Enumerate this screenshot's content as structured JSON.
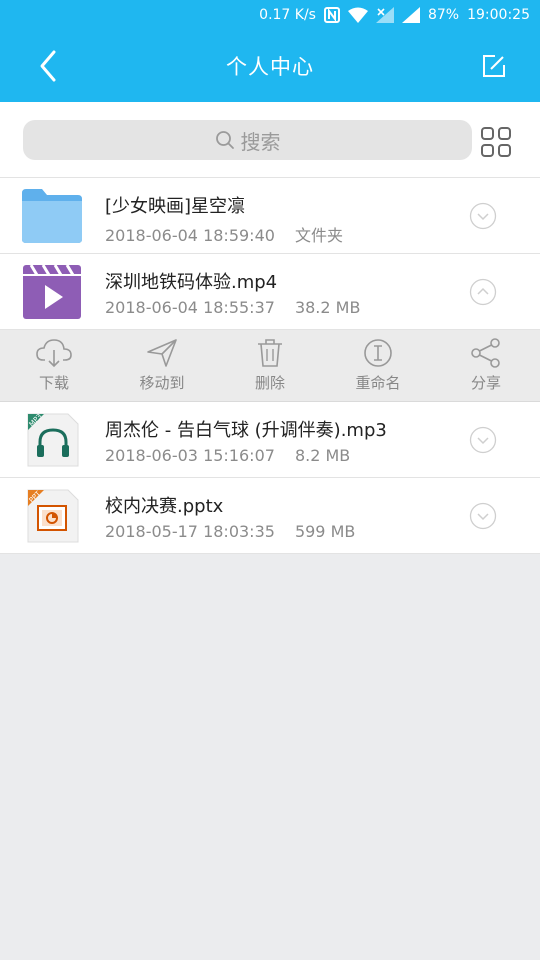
{
  "status_bar": {
    "net_speed": "0.17 K/s",
    "battery": "87%",
    "time": "19:00:25",
    "icons": [
      "nfc-icon",
      "wifi-icon",
      "signal-x-icon",
      "signal-icon"
    ]
  },
  "header": {
    "title": "个人中心",
    "back_icon": "chevron-left-icon",
    "edit_icon": "edit-icon"
  },
  "search": {
    "placeholder": "搜索",
    "icon": "search-icon",
    "grid_icon": "grid-view-icon"
  },
  "files": [
    {
      "name": "[少女映画]星空凛",
      "date": "2018-06-04 18:59:40",
      "info": "文件夹",
      "type": "folder",
      "expanded": false
    },
    {
      "name": "深圳地铁码体验.mp4",
      "date": "2018-06-04 18:55:37",
      "info": "38.2 MB",
      "type": "video",
      "expanded": true
    },
    {
      "name": "周杰伦 - 告白气球 (升调伴奏).mp3",
      "date": "2018-06-03 15:16:07",
      "info": "8.2 MB",
      "type": "audio",
      "expanded": false
    },
    {
      "name": "校内决赛.pptx",
      "date": "2018-05-17 18:03:35",
      "info": "599 MB",
      "type": "ppt",
      "expanded": false
    }
  ],
  "actions": [
    {
      "label": "下载",
      "icon": "cloud-download-icon"
    },
    {
      "label": "移动到",
      "icon": "send-icon"
    },
    {
      "label": "删除",
      "icon": "trash-icon"
    },
    {
      "label": "重命名",
      "icon": "rename-icon"
    },
    {
      "label": "分享",
      "icon": "share-icon"
    }
  ],
  "colors": {
    "accent": "#1fb7f0",
    "folder": "#7cc4f4",
    "video": "#8e5db5",
    "audio_tag": "#2e8b6e",
    "ppt_tag": "#e67e22"
  },
  "thumb_labels": {
    "audio": "MP3",
    "ppt": "PPT"
  }
}
